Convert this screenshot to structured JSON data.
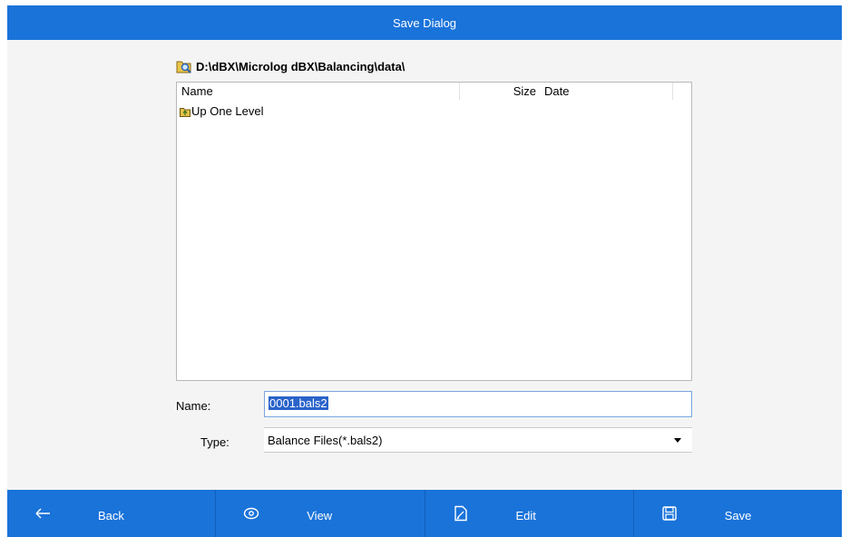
{
  "window": {
    "title": "Save Dialog"
  },
  "path": {
    "current": "D:\\dBX\\Microlog dBX\\Balancing\\data\\"
  },
  "file_list": {
    "columns": [
      "Name",
      "Size",
      "Date"
    ],
    "rows": [
      {
        "name": "Up One Level",
        "icon": "folder-up-icon"
      }
    ]
  },
  "form": {
    "name_label": "Name:",
    "name_value": "0001.bals2",
    "type_label": "Type:",
    "type_value": "Balance Files(*.bals2)"
  },
  "toolbar": {
    "buttons": [
      {
        "label": "Back",
        "icon": "arrow-left-icon"
      },
      {
        "label": "View",
        "icon": "eye-icon"
      },
      {
        "label": "Edit",
        "icon": "edit-document-icon"
      },
      {
        "label": "Save",
        "icon": "floppy-disk-icon"
      }
    ]
  },
  "colors": {
    "accent": "#1a73d9",
    "selection": "#2a63c9"
  }
}
